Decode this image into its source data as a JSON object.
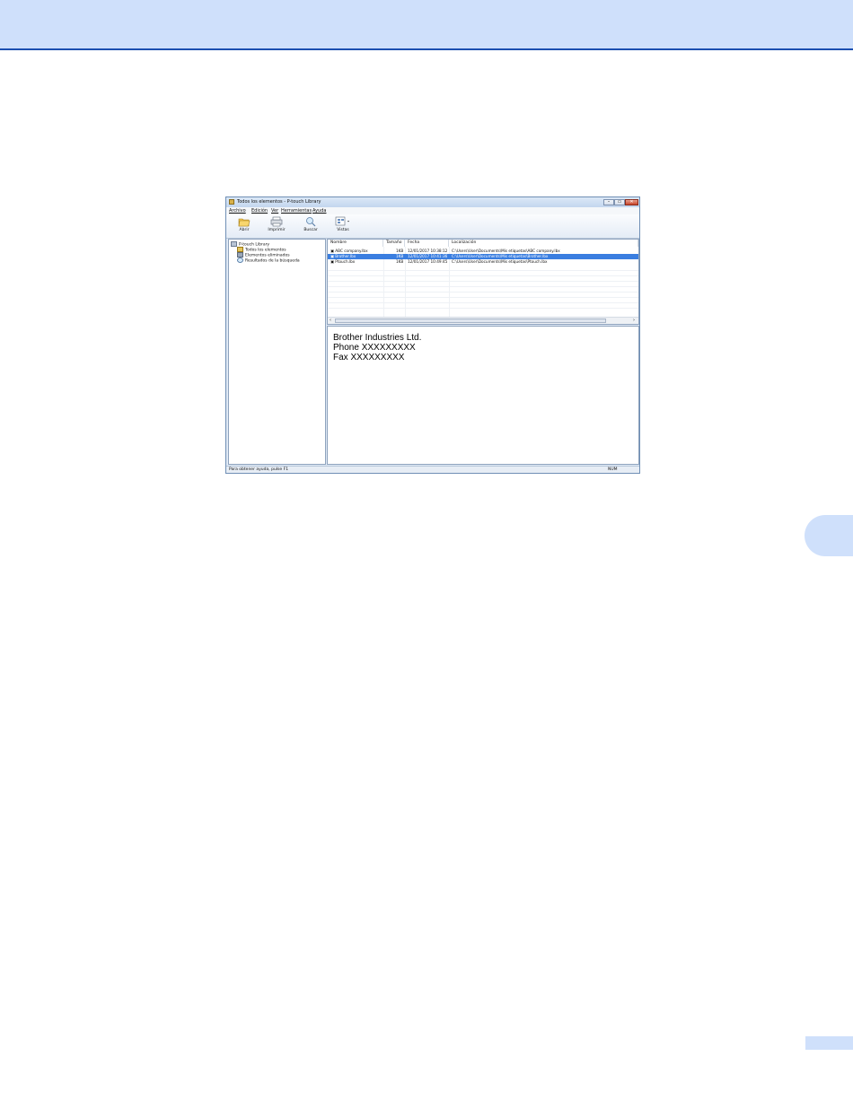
{
  "window": {
    "title": "Todos los elementos - P-touch Library",
    "controls": {
      "minimize": "–",
      "maximize": "▭",
      "close": "✕"
    }
  },
  "menu": [
    "Archivo",
    "Edición",
    "Ver",
    "Herramientas",
    "Ayuda"
  ],
  "toolbar": {
    "open": "Abrir",
    "print": "Imprimir",
    "search": "Buscar",
    "views": "Vistas"
  },
  "tree": {
    "root": "P-touch Library",
    "items": [
      "Todos los elementos",
      "Elementos eliminados",
      "Resultados de la búsqueda"
    ]
  },
  "list": {
    "columns": [
      "Nombre",
      "Tamaño",
      "Fecha",
      "Localización"
    ],
    "rows": [
      {
        "name": "ABC company.lbx",
        "size": "1KB",
        "date": "12/01/2017 10:38:12",
        "location": "C:\\Users\\User\\Documents\\Mis etiquetas\\ABC company.lbx",
        "selected": false
      },
      {
        "name": "Brother.lbx",
        "size": "1KB",
        "date": "12/01/2017 10:41:36",
        "location": "C:\\Users\\User\\Documents\\Mis etiquetas\\Brother.lbx",
        "selected": true
      },
      {
        "name": "Ptouch.lbx",
        "size": "1KB",
        "date": "12/01/2017 10:49:45",
        "location": "C:\\Users\\User\\Documents\\Mis etiquetas\\Ptouch.lbx",
        "selected": false
      }
    ]
  },
  "preview": {
    "lines": [
      "Brother Industries Ltd.",
      "Phone XXXXXXXXX",
      "Fax XXXXXXXXX"
    ]
  },
  "status": {
    "message": "Para obtener ayuda, pulse F1",
    "num": "NUM"
  }
}
